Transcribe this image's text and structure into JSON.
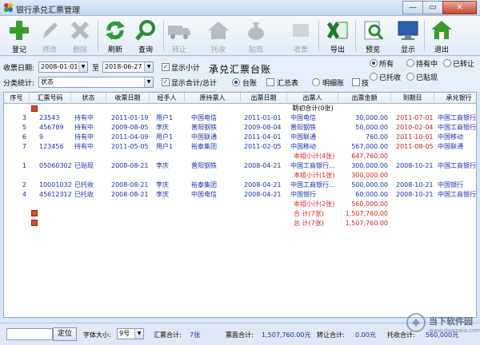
{
  "window": {
    "title": "银行承兑汇票管理",
    "min": "—",
    "restore": "▭",
    "close": "✕"
  },
  "toolbar": {
    "buttons": [
      {
        "label": "登记",
        "icon": "add-icon"
      },
      {
        "label": "修改",
        "icon": "edit-icon"
      },
      {
        "label": "删除",
        "icon": "delete-icon"
      },
      {
        "label": "刷新",
        "icon": "refresh-icon"
      },
      {
        "label": "查询",
        "icon": "search-icon"
      },
      {
        "label": "转让",
        "icon": "truck-icon"
      },
      {
        "label": "托收",
        "icon": "house-icon"
      },
      {
        "label": "贴现",
        "icon": "money-bag-icon"
      },
      {
        "label": "收票",
        "icon": "receive-icon"
      },
      {
        "label": "导出",
        "icon": "excel-icon"
      },
      {
        "label": "预览",
        "icon": "preview-icon"
      },
      {
        "label": "显示",
        "icon": "monitor-icon"
      },
      {
        "label": "退出",
        "icon": "exit-icon"
      }
    ]
  },
  "filters": {
    "date_label": "收票日期:",
    "date_from": "2008-01-01",
    "to_label": "至",
    "date_to": "2018-06-27",
    "show_subtotal": "显示小计",
    "category_label": "分类统计:",
    "category_value": "状态",
    "show_total": "显示合计/总计",
    "main_title": "承兑汇票台账",
    "view_ledger": "台账",
    "view_summary": "汇总表",
    "view_detail": "明细账",
    "view_fourth": "技",
    "status_all": "所有",
    "status_holding": "持有中",
    "status_transferred": "已转让",
    "status_collected": "已托收",
    "status_discounted": "已贴现"
  },
  "grid": {
    "headers": [
      "序号",
      "汇票号码",
      "状态",
      "收票日期",
      "经手人",
      "原持票人",
      "出票日期",
      "出票人",
      "出票金额",
      "到期日",
      "承兑银行"
    ],
    "opening": "期初合计(0张)",
    "rows": [
      {
        "no": "3",
        "num": "23543",
        "status": "持有中",
        "recv": "2011-01-19",
        "handler": "用户1",
        "orig": "中国电信",
        "issue": "2011-01-01",
        "drawer": "中国电信",
        "amount": "30,000.00",
        "due": "2011-07-01",
        "bank": "中国工商银行"
      },
      {
        "no": "5",
        "num": "456789",
        "status": "持有中",
        "recv": "2009-08-05",
        "handler": "李庆",
        "orig": "普阳钢铁",
        "issue": "2009-08-04",
        "drawer": "普阳钢铁",
        "amount": "50,000.00",
        "due": "2010-02-04",
        "bank": "中国工商银行"
      },
      {
        "no": "6",
        "num": "9",
        "status": "持有中",
        "recv": "2011-04-09",
        "handler": "用户1",
        "orig": "中国联通",
        "issue": "2011-04-01",
        "drawer": "中国联通",
        "amount": "760.00",
        "due": "2011-10-01",
        "bank": "中国移动"
      },
      {
        "no": "7",
        "num": "123456",
        "status": "持有中",
        "recv": "2011-05-05",
        "handler": "用户1",
        "orig": "裕泰集团",
        "issue": "2011-02-05",
        "drawer": "中国移动",
        "amount": "567,000.00",
        "due": "2011-08-05",
        "bank": "中国联通"
      },
      {
        "subtotal": "本组小计(4张)",
        "amount": "647,760.00"
      },
      {
        "no": "1",
        "num": "05060302",
        "status": "已贴现",
        "recv": "2008-08-21",
        "handler": "李庆",
        "orig": "普阳钢铁",
        "issue": "2008-04-21",
        "drawer": "中国工商银行...",
        "amount": "300,000.00",
        "due": "2008-10-21",
        "bank": "中国工商银行"
      },
      {
        "subtotal": "本组小计(1张)",
        "amount": "300,000.00"
      },
      {
        "no": "2",
        "num": "10001032",
        "status": "已托收",
        "recv": "2008-08-21",
        "handler": "李庆",
        "orig": "裕泰集团",
        "issue": "2008-04-21",
        "drawer": "中国工商银行...",
        "amount": "500,000.00",
        "due": "2008-10-21",
        "bank": "中国银行"
      },
      {
        "no": "4",
        "num": "45612312",
        "status": "已托收",
        "recv": "2008-08-21",
        "handler": "李庆",
        "orig": "中国电信",
        "issue": "2008-04-21",
        "drawer": "中国银行",
        "amount": "60,000.00",
        "due": "2008-10-21",
        "bank": "中国工商银行"
      },
      {
        "subtotal": "本组小计(2张)",
        "amount": "560,000.00"
      },
      {
        "subtotal": "合    计(7张)",
        "amount": "1,507,760.00"
      },
      {
        "subtotal": "总    计(7张)",
        "amount": "1,507,760.00"
      }
    ]
  },
  "status": {
    "locate_btn": "定位",
    "font_size_label": "字体大小:",
    "font_size_value": "9号",
    "count_label": "汇票合计:",
    "count_value": "7张",
    "face_label": "票面合计:",
    "face_value": "1,507,760.00元",
    "transfer_label": "转让合计:",
    "transfer_value": "0.00元",
    "collect_label": "托收合计:",
    "collect_value": "560,000元"
  },
  "watermark": {
    "text": "当下软件园",
    "sub": "www.downxia.com"
  }
}
